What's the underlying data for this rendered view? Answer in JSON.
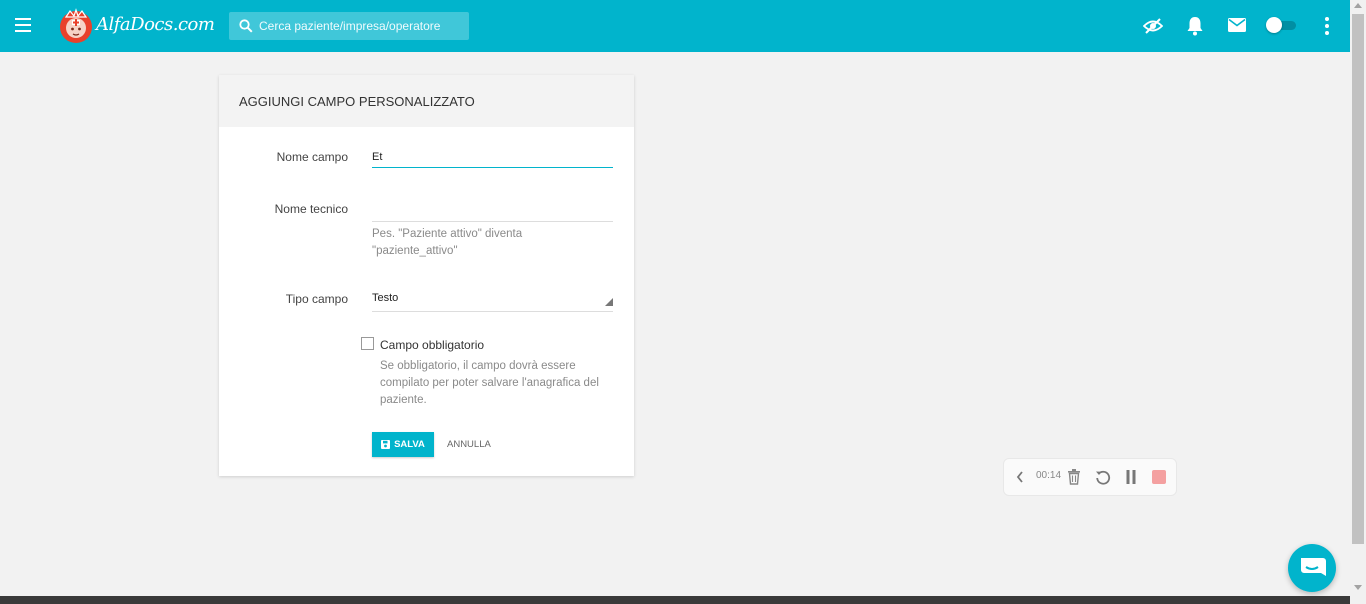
{
  "header": {
    "logo_text": "AlfaDocs.com",
    "search_placeholder": "Cerca paziente/impresa/operatore",
    "icons": [
      "menu-icon",
      "privacy-eye-icon",
      "bell-icon",
      "mail-icon",
      "theme-toggle",
      "more-vert-icon"
    ],
    "accent_color": "#01b4cc"
  },
  "form": {
    "title": "AGGIUNGI CAMPO PERSONALIZZATO",
    "name_label": "Nome campo",
    "name_value": "Et",
    "tech_label": "Nome tecnico",
    "tech_value": "",
    "tech_help": "Pes. \"Paziente attivo\" diventa \"paziente_attivo\"",
    "type_label": "Tipo campo",
    "type_value": "Testo",
    "required_label": "Campo obbligatorio",
    "required_checked": false,
    "required_help": "Se obbligatorio, il campo dovrà essere compilato per poter salvare l'anagrafica del paziente.",
    "save_label": "SALVA",
    "cancel_label": "ANNULLA"
  },
  "recorder": {
    "time": "00:14",
    "icons": [
      "chevron-left-icon",
      "trash-icon",
      "restart-icon",
      "pause-icon",
      "stop-icon"
    ]
  },
  "chat": {
    "icon": "chat-bubble-icon"
  }
}
